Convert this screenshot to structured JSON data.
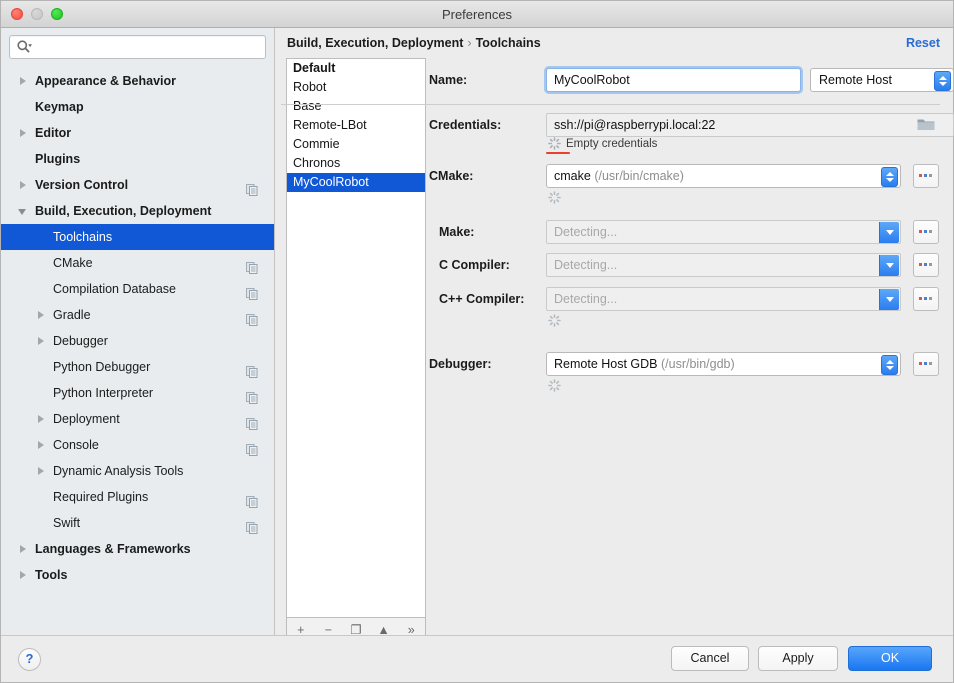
{
  "window": {
    "title": "Preferences",
    "traffic_lights": [
      "close",
      "minimize",
      "maximize"
    ]
  },
  "sidebar": {
    "search": {
      "value": "",
      "placeholder": ""
    },
    "items": [
      {
        "label": "Appearance & Behavior",
        "level": 0,
        "twisty": "right",
        "bold": true,
        "copy": false,
        "selected": false
      },
      {
        "label": "Keymap",
        "level": 0,
        "twisty": "none",
        "bold": true,
        "copy": false,
        "selected": false
      },
      {
        "label": "Editor",
        "level": 0,
        "twisty": "right",
        "bold": true,
        "copy": false,
        "selected": false
      },
      {
        "label": "Plugins",
        "level": 0,
        "twisty": "none",
        "bold": true,
        "copy": false,
        "selected": false
      },
      {
        "label": "Version Control",
        "level": 0,
        "twisty": "right",
        "bold": true,
        "copy": true,
        "selected": false
      },
      {
        "label": "Build, Execution, Deployment",
        "level": 0,
        "twisty": "down",
        "bold": true,
        "copy": false,
        "selected": false
      },
      {
        "label": "Toolchains",
        "level": 1,
        "twisty": "none",
        "bold": true,
        "copy": false,
        "selected": true
      },
      {
        "label": "CMake",
        "level": 1,
        "twisty": "none",
        "bold": false,
        "copy": true,
        "selected": false
      },
      {
        "label": "Compilation Database",
        "level": 1,
        "twisty": "none",
        "bold": false,
        "copy": true,
        "selected": false
      },
      {
        "label": "Gradle",
        "level": 1,
        "twisty": "right",
        "bold": false,
        "copy": true,
        "selected": false
      },
      {
        "label": "Debugger",
        "level": 1,
        "twisty": "right",
        "bold": false,
        "copy": false,
        "selected": false
      },
      {
        "label": "Python Debugger",
        "level": 1,
        "twisty": "none",
        "bold": false,
        "copy": true,
        "selected": false
      },
      {
        "label": "Python Interpreter",
        "level": 1,
        "twisty": "none",
        "bold": false,
        "copy": true,
        "selected": false
      },
      {
        "label": "Deployment",
        "level": 1,
        "twisty": "right",
        "bold": false,
        "copy": true,
        "selected": false
      },
      {
        "label": "Console",
        "level": 1,
        "twisty": "right",
        "bold": false,
        "copy": true,
        "selected": false
      },
      {
        "label": "Dynamic Analysis Tools",
        "level": 1,
        "twisty": "right",
        "bold": false,
        "copy": false,
        "selected": false
      },
      {
        "label": "Required Plugins",
        "level": 1,
        "twisty": "none",
        "bold": false,
        "copy": true,
        "selected": false
      },
      {
        "label": "Swift",
        "level": 1,
        "twisty": "none",
        "bold": false,
        "copy": true,
        "selected": false
      },
      {
        "label": "Languages & Frameworks",
        "level": 0,
        "twisty": "right",
        "bold": true,
        "copy": false,
        "selected": false
      },
      {
        "label": "Tools",
        "level": 0,
        "twisty": "right",
        "bold": true,
        "copy": false,
        "selected": false
      }
    ]
  },
  "content": {
    "breadcrumb": {
      "parent": "Build, Execution, Deployment",
      "separator": "›",
      "current": "Toolchains"
    },
    "reset_label": "Reset",
    "toolchain_list": {
      "items": [
        {
          "label": "Default",
          "bold": true,
          "selected": false
        },
        {
          "label": "Robot",
          "bold": false,
          "selected": false
        },
        {
          "label": "Base",
          "bold": false,
          "selected": false
        },
        {
          "label": "Remote-LBot",
          "bold": false,
          "selected": false
        },
        {
          "label": "Commie",
          "bold": false,
          "selected": false
        },
        {
          "label": "Chronos",
          "bold": false,
          "selected": false
        },
        {
          "label": "MyCoolRobot",
          "bold": false,
          "selected": true
        }
      ],
      "toolbar": [
        {
          "name": "add",
          "glyph": "+"
        },
        {
          "name": "remove",
          "glyph": "−"
        },
        {
          "name": "copy",
          "glyph": "❐"
        },
        {
          "name": "move-up",
          "glyph": "▲"
        },
        {
          "name": "overflow",
          "glyph": "»"
        }
      ]
    },
    "form": {
      "name": {
        "label": "Name:",
        "value": "MyCoolRobot",
        "type_select": {
          "value": "Remote Host"
        }
      },
      "credentials": {
        "label": "Credentials:",
        "value": "ssh://pi@raspberrypi.local:22",
        "status": "Empty credentials",
        "error_color": "#e8412f"
      },
      "cmake": {
        "label": "CMake:",
        "value": "cmake",
        "path": "(/usr/bin/cmake)",
        "browse": "..."
      },
      "make": {
        "label": "Make:",
        "placeholder": "Detecting...",
        "browse": "..."
      },
      "c_compiler": {
        "label": "C Compiler:",
        "placeholder": "Detecting...",
        "browse": "..."
      },
      "cxx_compiler": {
        "label": "C++ Compiler:",
        "placeholder": "Detecting...",
        "browse": "..."
      },
      "debugger": {
        "label": "Debugger:",
        "value": "Remote Host GDB",
        "path": "(/usr/bin/gdb)",
        "browse": "..."
      }
    }
  },
  "footer": {
    "help_glyph": "?",
    "cancel_label": "Cancel",
    "apply_label": "Apply",
    "ok_label": "OK"
  },
  "colors": {
    "selection_blue": "#1158d6",
    "accent_blue": "#2a7df0",
    "link_blue": "#2a6bd4",
    "error_red": "#e8412f",
    "sidebar_bg": "#e8ecef",
    "panel_bg": "#ececec"
  }
}
